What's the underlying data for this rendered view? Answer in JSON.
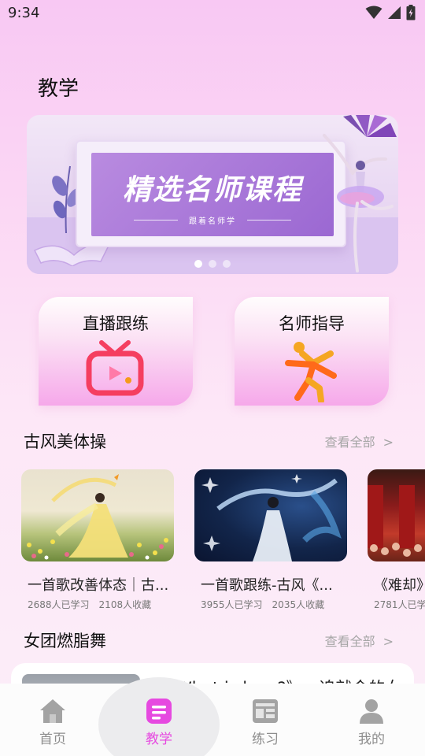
{
  "status_bar": {
    "time": "9:34"
  },
  "page": {
    "title": "教学"
  },
  "banner": {
    "headline": "精选名师课程",
    "subtitle": "跟着名师学",
    "dots": 3,
    "active_dot": 0
  },
  "features": [
    {
      "label": "直播跟练",
      "icon": "tv-play-icon"
    },
    {
      "label": "名师指导",
      "icon": "dancer-icon"
    }
  ],
  "sections": {
    "classical": {
      "title": "古风美体操",
      "more": "查看全部",
      "chevron": ">"
    },
    "girl_group": {
      "title": "女团燃脂舞",
      "more": "查看全部",
      "chevron": ">"
    }
  },
  "videos": [
    {
      "title": "一首歌改善体态｜古...",
      "learners": "2688人已学习",
      "favorites": "2108人收藏"
    },
    {
      "title": "一首歌跟练-古风《...",
      "learners": "3955人已学习",
      "favorites": "2035人收藏"
    },
    {
      "title": "《难却》",
      "learners": "2781人已学",
      "favorites": ""
    }
  ],
  "list_items": [
    {
      "title": "《What is love?》 - 追就金的女"
    }
  ],
  "tabs": [
    {
      "label": "首页",
      "icon": "home-icon",
      "active": false
    },
    {
      "label": "教学",
      "icon": "teach-icon",
      "active": true
    },
    {
      "label": "练习",
      "icon": "practice-icon",
      "active": false
    },
    {
      "label": "我的",
      "icon": "profile-icon",
      "active": false
    }
  ],
  "colors": {
    "accent": "#e649e0",
    "inactive_tab": "#8d8d8d"
  }
}
